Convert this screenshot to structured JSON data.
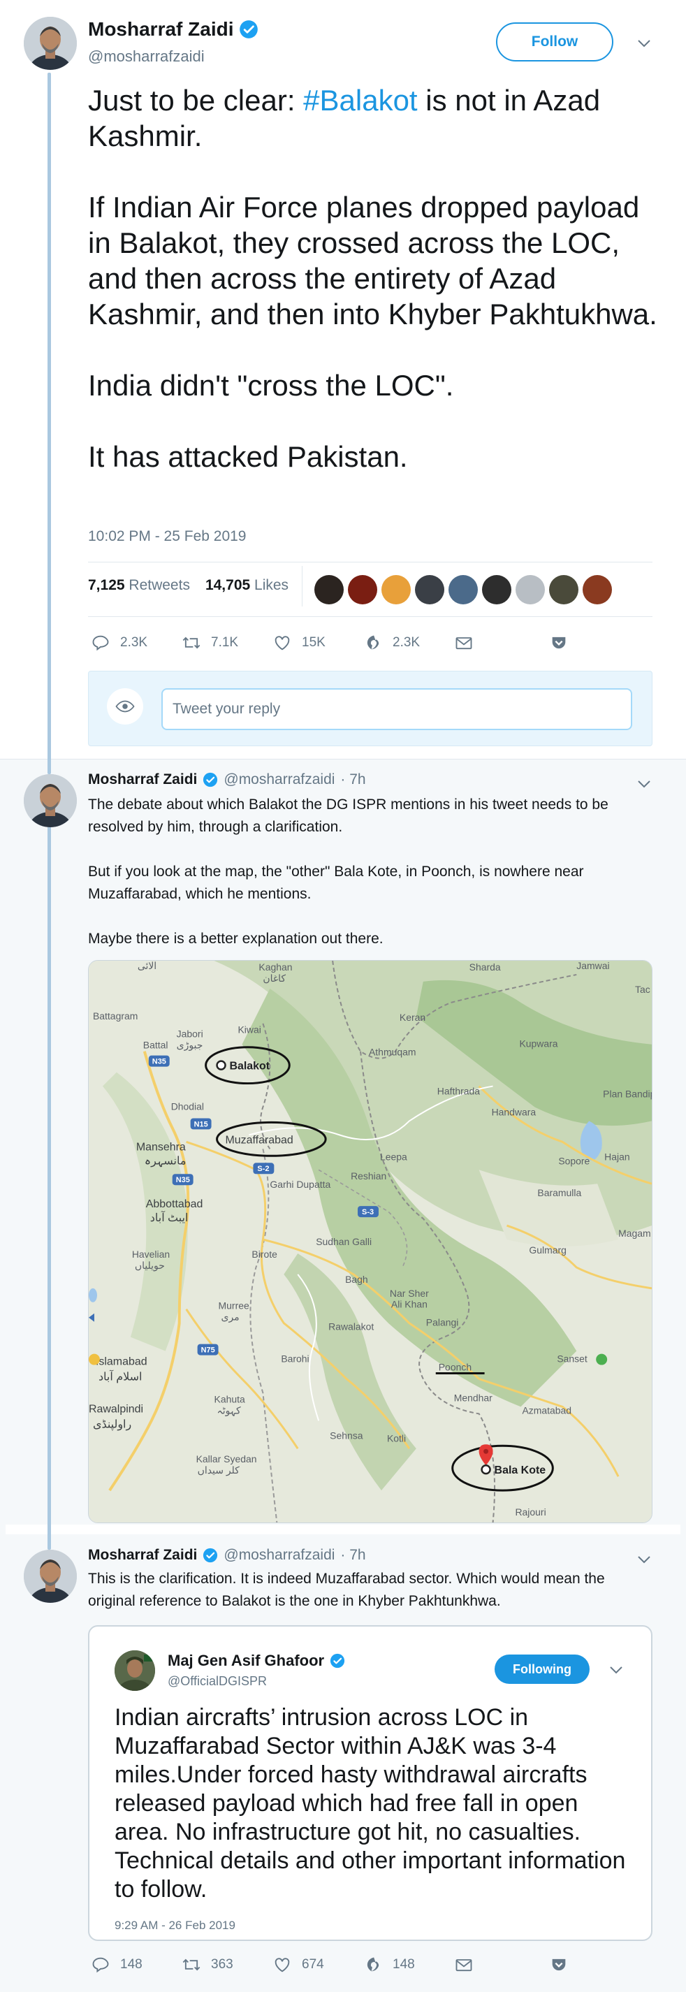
{
  "main_tweet": {
    "author_name": "Mosharraf Zaidi",
    "handle": "@mosharrafzaidi",
    "follow_label": "Follow",
    "text_parts": {
      "p1_before": "Just to be clear: ",
      "hashtag": "#Balakot",
      "p1_after": " is not in Azad Kashmir."
    },
    "paragraphs": [
      "If Indian Air Force planes dropped payload in Balakot, they crossed across the LOC, and then across the entirety of Azad Kashmir, and then into Khyber Pakhtukhwa.",
      "India didn't \"cross the LOC\".",
      "It has attacked Pakistan."
    ],
    "timestamp": "10:02 PM - 25 Feb 2019",
    "retweets_count": "7,125",
    "retweets_label": "Retweets",
    "likes_count": "14,705",
    "likes_label": "Likes",
    "liker_colors": [
      "#2b2420",
      "#7a1e12",
      "#e8a03a",
      "#3a3f46",
      "#4b6a8a",
      "#2d2d2d",
      "#b8bec4",
      "#4a4a3a",
      "#8a3a20"
    ],
    "actions": {
      "reply": "2.3K",
      "retweet": "7.1K",
      "like": "15K",
      "moment": "2.3K"
    }
  },
  "reply_box": {
    "placeholder": "Tweet your reply"
  },
  "thread_tweet_1": {
    "author_name": "Mosharraf Zaidi",
    "handle": "@mosharrafzaidi",
    "time": "· 7h",
    "paragraphs": [
      "The debate about which Balakot the DG ISPR mentions in his tweet needs to be resolved by him, through a clarification.",
      "But if you look at the map, the \"other\" Bala Kote, in Poonch, is nowhere near Muzaffarabad, which he mentions.",
      "Maybe there is a better explanation out there."
    ],
    "map_labels": {
      "balakot": "Balakot",
      "muzaffarabad": "Muzaffarabad",
      "bala_kote": "Bala Kote",
      "poonch": "Poonch",
      "kaghan": "Kaghan",
      "kaghan_urdu": "کاغان",
      "battagram": "Battagram",
      "jabori": "Jabori",
      "jabori_urdu": "جبوڑی",
      "battal": "Battal",
      "kiwai": "Kiwai",
      "keran": "Keran",
      "sharda": "Sharda",
      "jamwai": "Jamwai",
      "tac": "Tac",
      "athmuqam": "Athmuqam",
      "kupwara": "Kupwara",
      "hafthrada": "Hafthrada",
      "handwara": "Handwara",
      "plan_bandipora": "Plan\nBandipor",
      "dhodial": "Dhodial",
      "mansehra": "Mansehra",
      "mansehra_urdu": "مانسہرہ",
      "abbottabad": "Abbottabad",
      "abbottabad_urdu": "ایبٹ آباد",
      "garhi_dupatta": "Garhi Dupatta",
      "leepa": "Leepa",
      "reshian": "Reshian",
      "sopore": "Sopore",
      "hajan": "Hajan",
      "baramulla": "Baramulla",
      "havelian": "Havelian",
      "havelian_urdu": "حویلیاں",
      "birote": "Birote",
      "sudhan_galli": "Sudhan Galli",
      "gulmarg": "Gulmarg",
      "magam": "Magam",
      "bagh": "Bagh",
      "nar_sher_ali_khan": "Nar Sher\nAli Khan",
      "murree": "Murree",
      "murree_urdu": "مری",
      "palangi": "Palangi",
      "rawalakot": "Rawalakot",
      "islamabad": "Islamabad",
      "islamabad_urdu": "اسلام آباد",
      "barohi": "Barohi",
      "sanset": "Sanset",
      "rawalpindi": "Rawalpindi",
      "rawalpindi_urdu": "راولپنڈی",
      "kahuta": "Kahuta",
      "kahuta_urdu": "کہوٹہ",
      "sehnsa": "Sehnsa",
      "kotli": "Kotli",
      "mendhar": "Mendhar",
      "azmatabad": "Azmatabad",
      "kallar_syedan": "Kallar Syedan",
      "kallar_syedan_urdu": "کلر سیداں",
      "rajouri": "Rajouri",
      "alai_urdu": "الائی",
      "n35": "N35",
      "n15": "N15",
      "s2": "S-2",
      "s3": "S-3",
      "n75": "N75"
    }
  },
  "thread_tweet_2": {
    "author_name": "Mosharraf Zaidi",
    "handle": "@mosharrafzaidi",
    "time": "· 7h",
    "text": "This is the clarification. It is indeed Muzaffarabad sector. Which would mean the original reference to Balakot is the one in Khyber Pakhtunkhwa.",
    "quoted": {
      "author_name": "Maj Gen Asif Ghafoor",
      "handle": "@OfficialDGISPR",
      "following_label": "Following",
      "text": "Indian aircrafts’ intrusion across LOC in Muzaffarabad Sector within AJ&K was 3-4 miles.Under forced hasty withdrawal aircrafts released payload which had free fall in open area. No infrastructure got hit, no casualties. Technical details and other important information to follow.",
      "timestamp": "9:29 AM - 26 Feb 2019"
    },
    "actions": {
      "reply": "148",
      "retweet": "363",
      "like": "674",
      "moment": "148"
    }
  },
  "colors": {
    "accent": "#1b95e0",
    "muted": "#657786",
    "thread_line": "#aac8e0"
  }
}
